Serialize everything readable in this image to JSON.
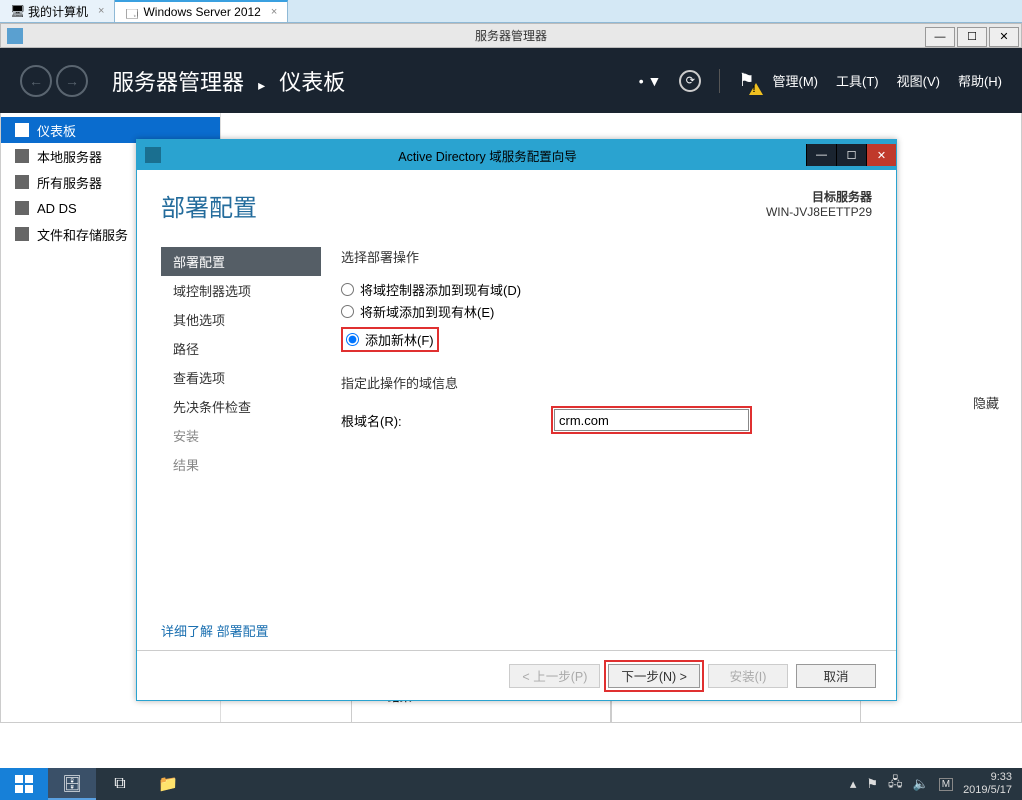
{
  "host_tabs": {
    "tab1": "我的计算机",
    "tab2": "Windows Server 2012"
  },
  "inner_window": {
    "title": "服务器管理器",
    "crumb_app": "服务器管理器",
    "crumb_page": "仪表板",
    "menu_manage": "管理(M)",
    "menu_tools": "工具(T)",
    "menu_view": "视图(V)",
    "menu_help": "帮助(H)"
  },
  "nav": {
    "dashboard": "仪表板",
    "local": "本地服务器",
    "all": "所有服务器",
    "adds": "AD DS",
    "file": "文件和存储服务"
  },
  "main": {
    "hide": "隐藏",
    "bpa": "BPA 结果"
  },
  "wizard": {
    "title": "Active Directory 域服务配置向导",
    "heading": "部署配置",
    "target_label": "目标服务器",
    "target_value": "WIN-JVJ8EETTP29",
    "steps": {
      "deploy": "部署配置",
      "dc": "域控制器选项",
      "other": "其他选项",
      "path": "路径",
      "review": "查看选项",
      "prereq": "先决条件检查",
      "install": "安装",
      "result": "结果"
    },
    "content": {
      "select_op": "选择部署操作",
      "opt1": "将域控制器添加到现有域(D)",
      "opt2": "将新域添加到现有林(E)",
      "opt3": "添加新林(F)",
      "specify": "指定此操作的域信息",
      "root_label": "根域名(R):",
      "root_value": "crm.com",
      "link": "详细了解 部署配置"
    },
    "buttons": {
      "prev": "< 上一步(P)",
      "next": "下一步(N) >",
      "install": "安装(I)",
      "cancel": "取消"
    }
  },
  "taskbar": {
    "time": "9:33",
    "date": "2019/5/17"
  }
}
